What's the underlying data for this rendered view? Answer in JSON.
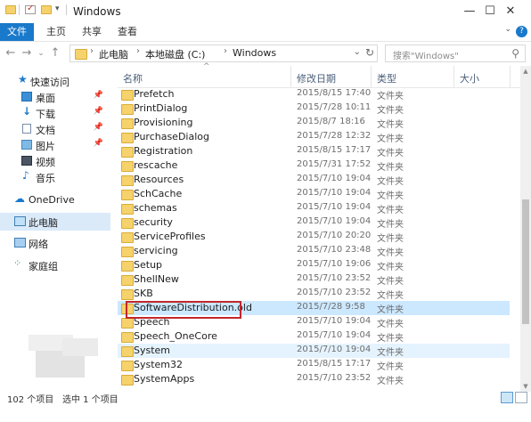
{
  "window": {
    "title": "Windows",
    "controls": {
      "minimize": "—",
      "maximize": "☐",
      "close": "✕"
    }
  },
  "ribbon": {
    "tabs": [
      "文件",
      "主页",
      "共享",
      "查看"
    ],
    "help": "?"
  },
  "addressbar": {
    "crumbs": [
      "此电脑",
      "本地磁盘 (C:)",
      "Windows"
    ],
    "search_placeholder": "搜索\"Windows\""
  },
  "nav": {
    "quick_access": "快速访问",
    "pinned": [
      "桌面",
      "下载",
      "文档",
      "图片"
    ],
    "others": [
      "视频",
      "音乐"
    ],
    "onedrive": "OneDrive",
    "this_pc": "此电脑",
    "network": "网络",
    "homegroup": "家庭组"
  },
  "columns": {
    "name": "名称",
    "date": "修改日期",
    "type": "类型",
    "size": "大小"
  },
  "files": [
    {
      "name": "Prefetch",
      "date": "2015/8/15 17:40",
      "type": "文件夹"
    },
    {
      "name": "PrintDialog",
      "date": "2015/7/28 10:11",
      "type": "文件夹"
    },
    {
      "name": "Provisioning",
      "date": "2015/8/7 18:16",
      "type": "文件夹"
    },
    {
      "name": "PurchaseDialog",
      "date": "2015/7/28 12:32",
      "type": "文件夹"
    },
    {
      "name": "Registration",
      "date": "2015/8/15 17:17",
      "type": "文件夹"
    },
    {
      "name": "rescache",
      "date": "2015/7/31 17:52",
      "type": "文件夹"
    },
    {
      "name": "Resources",
      "date": "2015/7/10 19:04",
      "type": "文件夹"
    },
    {
      "name": "SchCache",
      "date": "2015/7/10 19:04",
      "type": "文件夹"
    },
    {
      "name": "schemas",
      "date": "2015/7/10 19:04",
      "type": "文件夹"
    },
    {
      "name": "security",
      "date": "2015/7/10 19:04",
      "type": "文件夹"
    },
    {
      "name": "ServiceProfiles",
      "date": "2015/7/10 20:20",
      "type": "文件夹"
    },
    {
      "name": "servicing",
      "date": "2015/7/10 23:48",
      "type": "文件夹"
    },
    {
      "name": "Setup",
      "date": "2015/7/10 19:06",
      "type": "文件夹"
    },
    {
      "name": "ShellNew",
      "date": "2015/7/10 23:52",
      "type": "文件夹"
    },
    {
      "name": "SKB",
      "date": "2015/7/10 23:52",
      "type": "文件夹"
    },
    {
      "name": "SoftwareDistribution.old",
      "date": "2015/7/28 9:58",
      "type": "文件夹"
    },
    {
      "name": "Speech",
      "date": "2015/7/10 19:04",
      "type": "文件夹"
    },
    {
      "name": "Speech_OneCore",
      "date": "2015/7/10 19:04",
      "type": "文件夹"
    },
    {
      "name": "System",
      "date": "2015/7/10 19:04",
      "type": "文件夹"
    },
    {
      "name": "System32",
      "date": "2015/8/15 17:17",
      "type": "文件夹"
    },
    {
      "name": "SystemApps",
      "date": "2015/7/10 23:52",
      "type": "文件夹"
    }
  ],
  "selected_file": "SoftwareDistribution.old",
  "hover_file": "System",
  "status": {
    "count": "102 个项目",
    "selected": "选中 1 个项目"
  },
  "colors": {
    "accent": "#1979ca",
    "selection": "#cce8ff",
    "highlight_box": "#c1272d",
    "folder": "#f5d26b"
  }
}
